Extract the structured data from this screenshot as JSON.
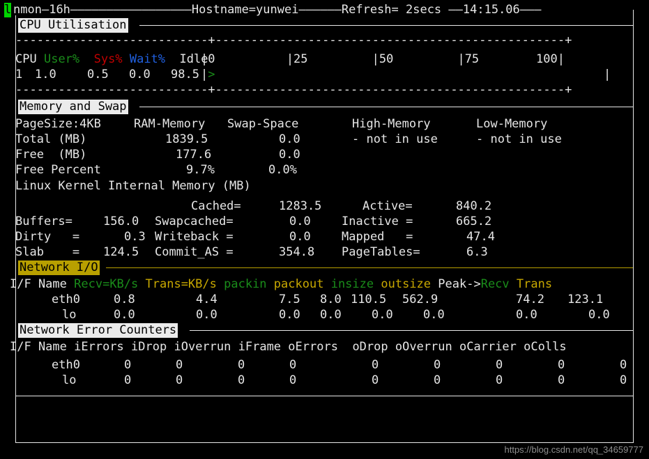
{
  "header": {
    "app": "nmon",
    "version": "16h",
    "hostname_label": "Hostname=yunwei",
    "refresh_label": "Refresh= 2secs",
    "time": "14:15.06",
    "cursor_char": "l",
    "line": "nmon—16h————————————————————Hostname=yunwei———————Refresh= 2secs ——14:15.06————"
  },
  "cpu": {
    "title": "CPU Utilisation",
    "rule": "---------------------------+-------------------------------------------------+",
    "columns": [
      "CPU",
      "User%",
      "Sys%",
      "Wait%",
      "Idle"
    ],
    "scale": "|0          |25         |50         |75        100|",
    "scale_ticks": [
      "0",
      "25",
      "50",
      "75",
      "100"
    ],
    "rows": [
      {
        "cpu": "1",
        "user": "1.0",
        "sys": "0.5",
        "wait": "0.0",
        "idle": "98.5",
        "bar": ">"
      }
    ]
  },
  "memory": {
    "title": "Memory and Swap",
    "pagesize": "PageSize:4KB",
    "col_ram": "RAM-Memory",
    "col_swap": "Swap-Space",
    "col_high": "High-Memory",
    "col_low": "Low-Memory",
    "rows": [
      {
        "label": "Total (MB)",
        "ram": "1839.5",
        "swap": "0.0",
        "high": "- not in use",
        "low": "- not in use"
      },
      {
        "label": "Free  (MB)",
        "ram": "177.6",
        "swap": "0.0",
        "high": "",
        "low": ""
      },
      {
        "label": "Free Percent",
        "ram": "9.7%",
        "swap": "0.0%",
        "high": "",
        "low": ""
      }
    ]
  },
  "kernel": {
    "title": "Linux Kernel Internal Memory (MB)",
    "rows": [
      {
        "l1": "",
        "v1": "",
        "l2": "Cached=",
        "v2": "1283.5",
        "l3": "Active=",
        "v3": "840.2"
      },
      {
        "l1": "Buffers=",
        "v1": "156.0",
        "l2": "Swapcached=",
        "v2": "0.0",
        "l3": "Inactive =",
        "v3": "665.2"
      },
      {
        "l1": "Dirty   =",
        "v1": "0.3",
        "l2": "Writeback =",
        "v2": "0.0",
        "l3": "Mapped   =",
        "v3": "47.4"
      },
      {
        "l1": "Slab    =",
        "v1": "124.5",
        "l2": "Commit_AS =",
        "v2": "354.8",
        "l3": "PageTables=",
        "v3": "6.3"
      }
    ]
  },
  "netio": {
    "title": "Network I/O",
    "columns": [
      "I/F Name",
      "Recv=KB/s",
      "Trans=KB/s",
      "packin",
      "packout",
      "insize",
      "outsize",
      "Peak->Recv",
      "Trans"
    ],
    "rows": [
      {
        "ifname": "eth0",
        "recv": "0.8",
        "trans": "4.4",
        "packin": "7.5",
        "packout": "8.0",
        "insize": "110.5",
        "outsize": "562.9",
        "peak_recv": "74.2",
        "peak_trans": "123.1"
      },
      {
        "ifname": "lo",
        "recv": "0.0",
        "trans": "0.0",
        "packin": "0.0",
        "packout": "0.0",
        "insize": "0.0",
        "outsize": "0.0",
        "peak_recv": "0.0",
        "peak_trans": "0.0"
      }
    ]
  },
  "neterr": {
    "title": "Network Error Counters",
    "columns": [
      "I/F Name",
      "iErrors",
      "iDrop",
      "iOverrun",
      "iFrame",
      "oErrors",
      "oDrop",
      "oOverrun",
      "oCarrier",
      "oColls"
    ],
    "rows": [
      {
        "ifname": "eth0",
        "ierrors": "0",
        "idrop": "0",
        "ioverrun": "0",
        "iframe": "0",
        "oerrors": "0",
        "odrop": "0",
        "ooverrun": "0",
        "ocarrier": "0",
        "ocolls": "0"
      },
      {
        "ifname": "lo",
        "ierrors": "0",
        "idrop": "0",
        "ioverrun": "0",
        "iframe": "0",
        "oerrors": "0",
        "odrop": "0",
        "ooverrun": "0",
        "ocarrier": "0",
        "ocolls": "0"
      }
    ]
  },
  "watermark": "https://blog.csdn.net/qq_34659777",
  "colors": {
    "background": "#000000",
    "foreground": "#e8e8e8",
    "green": "#1a8c1a",
    "red": "#c00000",
    "blue": "#2060e0",
    "yellow": "#c8a800",
    "magenta": "#c000c0",
    "cyan": "#00c8c8",
    "cursor": "#00d400",
    "chip_bg": "#ebebeb",
    "chip_yellow_bg": "#b8a000"
  }
}
